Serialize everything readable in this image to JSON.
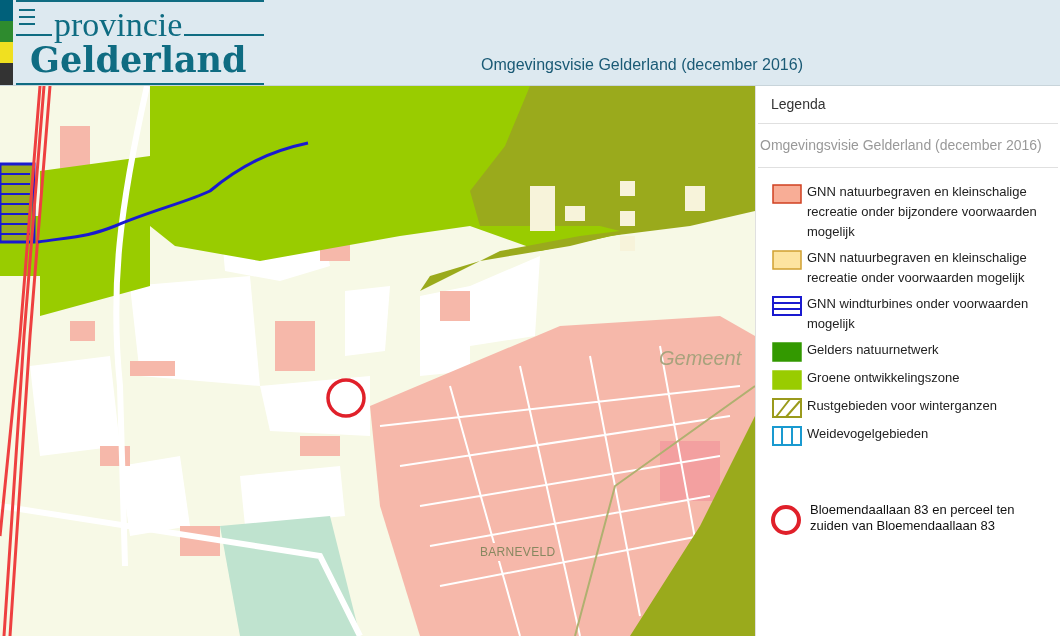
{
  "header": {
    "logo_top": "provincie",
    "logo_bottom": "Gelderland",
    "title": "Omgevingsvisie Gelderland (december 2016)"
  },
  "map": {
    "labels": [
      {
        "kind": "municipality",
        "text": "Gemeent"
      },
      {
        "kind": "town",
        "text": "BARNEVELD"
      }
    ]
  },
  "legend": {
    "title": "Legenda",
    "layer": "Omgevingsvisie Gelderland (december 2016)",
    "items": [
      {
        "kind": "fill",
        "color": "#f8ad96",
        "label": "GNN natuurbegraven en kleinschalige recreatie onder bijzondere voorwaarden mogelijk"
      },
      {
        "kind": "fill",
        "color": "#fde4a0",
        "label": "GNN natuurbegraven en kleinschalige recreatie onder voorwaarden mogelijk"
      },
      {
        "kind": "horizontal-hatch",
        "color": "#1a1ad0",
        "label": "GNN windturbines onder voorwaarden mogelijk"
      },
      {
        "kind": "fill",
        "color": "#339900",
        "label": "Gelders natuurnetwerk"
      },
      {
        "kind": "fill",
        "color": "#99cc00",
        "label": "Groene ontwikkelingszone"
      },
      {
        "kind": "diagonal-hatch",
        "color": "#9a9a1c",
        "label": "Rustgebieden voor winterganzen"
      },
      {
        "kind": "vertical-hatch",
        "color": "#1a9ad0",
        "label": "Weidevogelgebieden"
      }
    ],
    "marker": {
      "kind": "circle",
      "color": "#e0202a",
      "label": "Bloemendaallaan 83 en perceel ten zuiden van Bloemendaallaan 83"
    }
  }
}
